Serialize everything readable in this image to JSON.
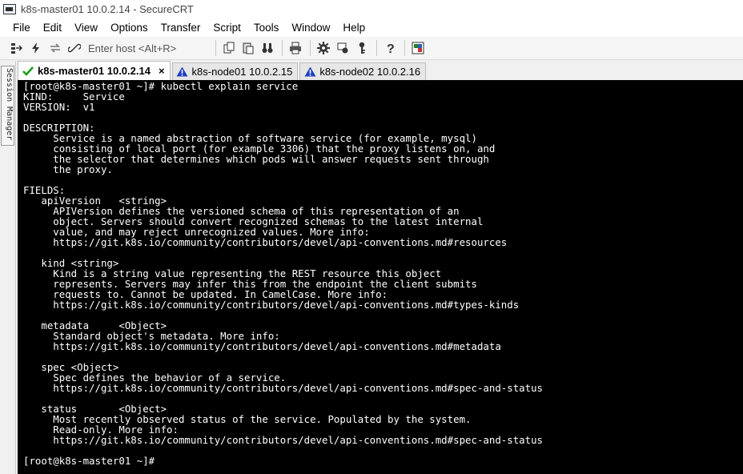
{
  "window": {
    "title": "k8s-master01 10.0.2.14 - SecureCRT"
  },
  "menu": [
    "File",
    "Edit",
    "View",
    "Options",
    "Transfer",
    "Script",
    "Tools",
    "Window",
    "Help"
  ],
  "toolbar": {
    "host_placeholder": "Enter host <Alt+R>"
  },
  "session_manager": {
    "label": "Session Manager"
  },
  "tabs": [
    {
      "label": "k8s-master01 10.0.2.14",
      "status": "connected",
      "status_color": "#1a9e1a",
      "active": true,
      "close": "×"
    },
    {
      "label": "k8s-node01 10.0.2.15",
      "status": "warning",
      "status_color": "#1f3fbf",
      "active": false
    },
    {
      "label": "k8s-node02 10.0.2.16",
      "status": "warning",
      "status_color": "#1f3fbf",
      "active": false
    }
  ],
  "terminal": {
    "text": "[root@k8s-master01 ~]# kubectl explain service\nKIND:     Service\nVERSION:  v1\n\nDESCRIPTION:\n     Service is a named abstraction of software service (for example, mysql)\n     consisting of local port (for example 3306) that the proxy listens on, and\n     the selector that determines which pods will answer requests sent through\n     the proxy.\n\nFIELDS:\n   apiVersion   <string>\n     APIVersion defines the versioned schema of this representation of an\n     object. Servers should convert recognized schemas to the latest internal\n     value, and may reject unrecognized values. More info:\n     https://git.k8s.io/community/contributors/devel/api-conventions.md#resources\n\n   kind <string>\n     Kind is a string value representing the REST resource this object\n     represents. Servers may infer this from the endpoint the client submits\n     requests to. Cannot be updated. In CamelCase. More info:\n     https://git.k8s.io/community/contributors/devel/api-conventions.md#types-kinds\n\n   metadata     <Object>\n     Standard object's metadata. More info:\n     https://git.k8s.io/community/contributors/devel/api-conventions.md#metadata\n\n   spec <Object>\n     Spec defines the behavior of a service.\n     https://git.k8s.io/community/contributors/devel/api-conventions.md#spec-and-status\n\n   status       <Object>\n     Most recently observed status of the service. Populated by the system.\n     Read-only. More info:\n     https://git.k8s.io/community/contributors/devel/api-conventions.md#spec-and-status\n\n[root@k8s-master01 ~]#"
  }
}
